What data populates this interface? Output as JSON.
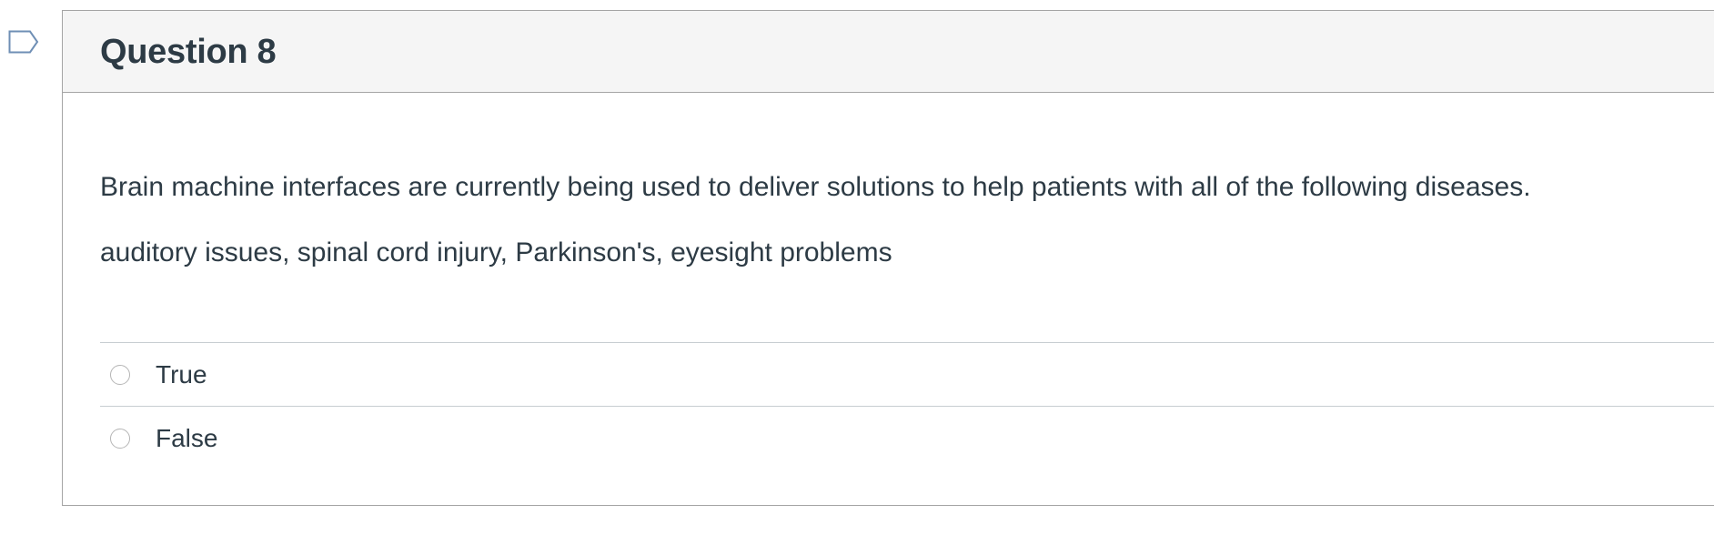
{
  "question": {
    "title": "Question 8",
    "text": "Brain machine interfaces are currently being used to deliver solutions to help patients with all of the following diseases.",
    "subtext": "auditory issues, spinal cord injury, Parkinson's, eyesight problems",
    "answers": [
      {
        "label": "True",
        "selected": false
      },
      {
        "label": "False",
        "selected": false
      }
    ]
  },
  "icons": {
    "flag": "flag-question-icon"
  },
  "colors": {
    "header_bg": "#f5f5f5",
    "border": "#a5a5a5",
    "text": "#2d3b45",
    "flag": "#6f8fb5"
  }
}
